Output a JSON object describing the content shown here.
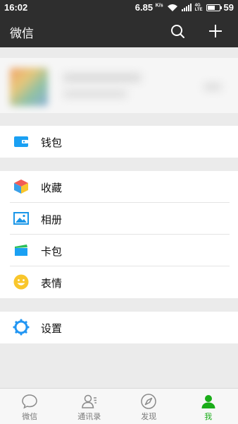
{
  "status_bar": {
    "time": "16:02",
    "network_speed": "6.85",
    "network_speed_unit": "K/s",
    "network_type": "4G",
    "network_sub": "LTE",
    "battery": "59"
  },
  "header": {
    "title": "微信",
    "search_icon": "search-icon",
    "add_icon": "plus-icon"
  },
  "menu": {
    "wallet": "钱包",
    "favorites": "收藏",
    "album": "相册",
    "cards": "卡包",
    "stickers": "表情",
    "settings": "设置"
  },
  "tabs": [
    {
      "label": "微信",
      "icon": "chat-bubble-icon",
      "active": false
    },
    {
      "label": "通讯录",
      "icon": "contacts-icon",
      "active": false
    },
    {
      "label": "发现",
      "icon": "compass-icon",
      "active": false
    },
    {
      "label": "我",
      "icon": "me-icon",
      "active": true
    }
  ],
  "colors": {
    "header_bg": "#2e2e2e",
    "accent_green": "#1aad19",
    "wallet_blue": "#1aa0f3",
    "settings_blue": "#2296f3",
    "sticker_yellow": "#f9c62b"
  }
}
